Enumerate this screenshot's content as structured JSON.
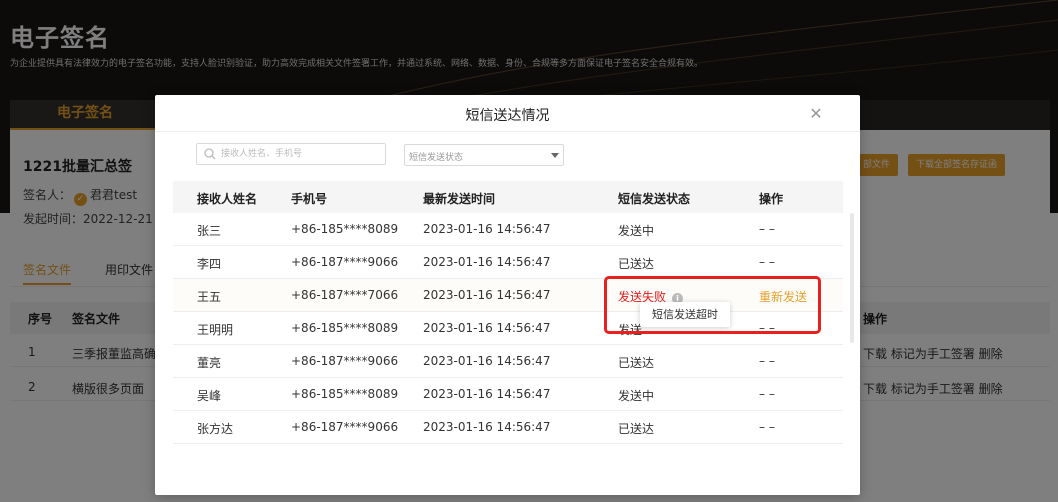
{
  "page": {
    "title": "电子签名",
    "description": "为企业提供具有法律效力的电子签名功能，支持人脸识别验证，助力高效完成相关文件签署工作，并通过系统、网络、数据、身份、合规等多方面保证电子签名安全合规有效。",
    "tab_active": "电子签名",
    "card_title": "1221批量汇总签",
    "signer_label": "签名人：",
    "signer_name": "君君test",
    "created_label": "发起时间：",
    "created_value": "2022-12-21",
    "btn_download_files": "部文件",
    "btn_download_certs": "下载全部签名存证函",
    "sub_tabs": [
      "签名文件",
      "用印文件"
    ],
    "table_headers": {
      "seq": "序号",
      "file": "签名文件",
      "ops": "操作"
    },
    "rows": [
      {
        "seq": "1",
        "file": "三季报董监高确",
        "ops": "下载 标记为手工签署 删除"
      },
      {
        "seq": "2",
        "file": "横版很多页面",
        "ops": "下载 标记为手工签署 删除"
      }
    ]
  },
  "modal": {
    "title": "短信送达情况",
    "search_placeholder": "接收人姓名、手机号",
    "status_placeholder": "短信发送状态",
    "headers": {
      "name": "接收人姓名",
      "phone": "手机号",
      "time": "最新发送时间",
      "status": "短信发送状态",
      "action": "操作"
    },
    "rows": [
      {
        "name": "张三",
        "phone": "+86-185****8089",
        "time": "2023-01-16 14:56:47",
        "status": "发送中",
        "action": "– –"
      },
      {
        "name": "李四",
        "phone": "+86-187****9066",
        "time": "2023-01-16 14:56:47",
        "status": "已送达",
        "action": "– –"
      },
      {
        "name": "王五",
        "phone": "+86-187****7066",
        "time": "2023-01-16 14:56:47",
        "status": "发送失败",
        "action": "重新发送"
      },
      {
        "name": "王明明",
        "phone": "+86-185****8089",
        "time": "2023-01-16 14:56:47",
        "status": "发送",
        "action": "– –"
      },
      {
        "name": "董亮",
        "phone": "+86-187****9066",
        "time": "2023-01-16 14:56:47",
        "status": "已送达",
        "action": "– –"
      },
      {
        "name": "吴峰",
        "phone": "+86-185****8089",
        "time": "2023-01-16 14:56:47",
        "status": "发送中",
        "action": "– –"
      },
      {
        "name": "张方达",
        "phone": "+86-187****9066",
        "time": "2023-01-16 14:56:47",
        "status": "已送达",
        "action": "– –"
      }
    ],
    "tooltip": "短信发送超时"
  },
  "colors": {
    "accent": "#e8a12b",
    "error": "#e02020",
    "highlight": "#e8211f"
  },
  "icons": {
    "search": "search-icon",
    "close": "close-icon",
    "check": "check-icon",
    "info": "info-icon",
    "dropdown": "chevron-down-icon"
  }
}
